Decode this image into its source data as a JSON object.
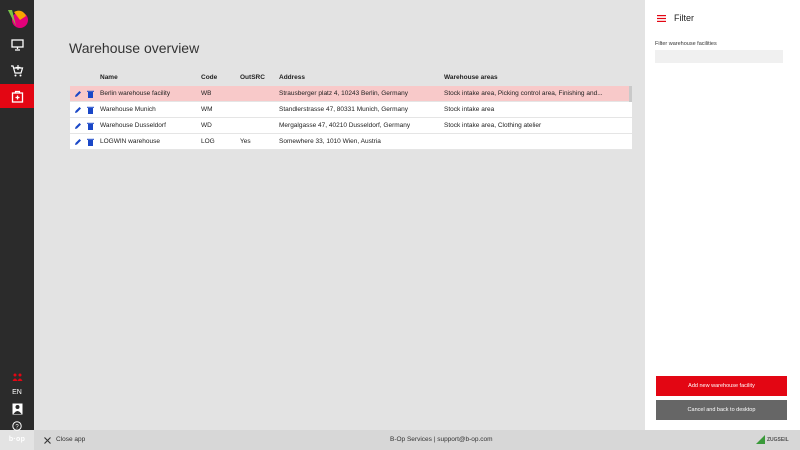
{
  "sidebar": {
    "items": [
      {
        "icon": "monitor-icon"
      },
      {
        "icon": "cart-add-icon"
      },
      {
        "icon": "warehouse-icon",
        "active": true
      }
    ],
    "language": "EN",
    "bottom_logo": "b·op",
    "accent_color": "#e30613"
  },
  "main": {
    "title": "Warehouse overview",
    "columns": {
      "name": "Name",
      "code": "Code",
      "outsrc": "OutSRC",
      "address": "Address",
      "areas": "Warehouse areas"
    },
    "rows": [
      {
        "name": "Berlin warehouse facility",
        "code": "WB",
        "outsrc": "",
        "address": "Strausberger platz 4, 10243 Berlin, Germany",
        "areas": "Stock intake area, Picking control area, Finishing and...",
        "selected": true
      },
      {
        "name": "Warehouse Munich",
        "code": "WM",
        "outsrc": "",
        "address": "Standlerstrasse 47, 80331 Munich, Germany",
        "areas": "Stock intake area"
      },
      {
        "name": "Warehouse Dusseldorf",
        "code": "WD",
        "outsrc": "",
        "address": "Mergalgasse 47, 40210 Dusseldorf, Germany",
        "areas": "Stock intake area, Clothing atelier"
      },
      {
        "name": "LOGWIN warehouse",
        "code": "LOG",
        "outsrc": "Yes",
        "address": "Somewhere 33, 1010 Wien, Austria",
        "areas": ""
      }
    ]
  },
  "filter": {
    "title": "Filter",
    "label": "Filter warehouse facilities",
    "value": "",
    "add_button": "Add new warehouse facility",
    "cancel_button": "Cancel and back to desktop"
  },
  "footer": {
    "close_label": "Close app",
    "center_text": "B-Op Services | support@b-op.com",
    "brand": "ZUGSEIL"
  }
}
